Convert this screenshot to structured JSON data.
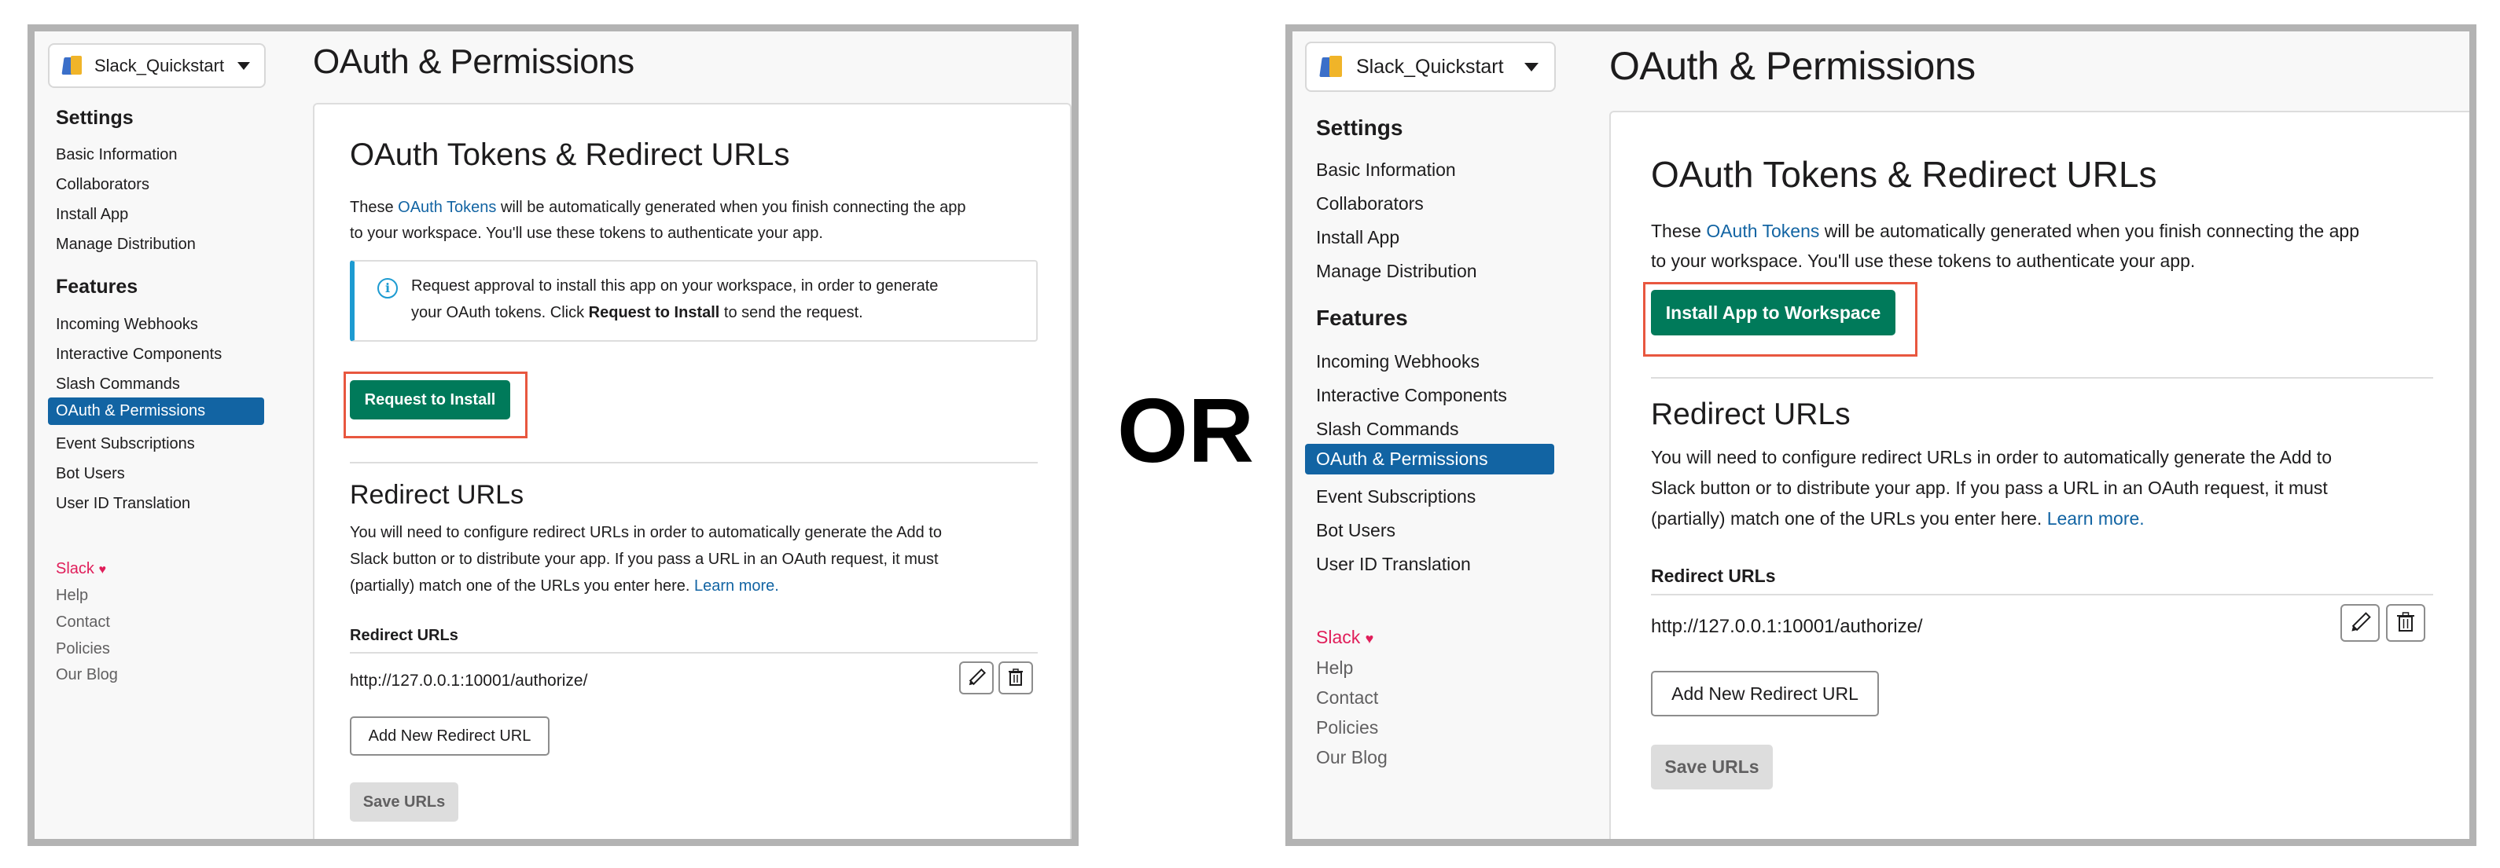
{
  "separator": "OR",
  "workspace": {
    "name": "Slack_Quickstart"
  },
  "sidebar": {
    "settings_heading": "Settings",
    "settings_items": [
      "Basic Information",
      "Collaborators",
      "Install App",
      "Manage Distribution"
    ],
    "features_heading": "Features",
    "features_items": [
      "Incoming Webhooks",
      "Interactive Components",
      "Slash Commands",
      "OAuth & Permissions",
      "Event Subscriptions",
      "Bot Users",
      "User ID Translation"
    ],
    "active_item": "OAuth & Permissions",
    "footer": {
      "slack": "Slack",
      "heart": "♥",
      "items": [
        "Help",
        "Contact",
        "Policies",
        "Our Blog"
      ]
    }
  },
  "page": {
    "title": "OAuth & Permissions",
    "tokens_heading": "OAuth Tokens & Redirect URLs",
    "tokens_desc_pre": "These ",
    "tokens_desc_link": "OAuth Tokens",
    "tokens_desc_post_1": " will be automatically generated when you finish connecting the app",
    "tokens_desc_post_2": "to your workspace. You'll use these tokens to authenticate your app.",
    "info_line1": "Request approval to install this app on your workspace, in order to generate",
    "info_line2_pre": "your OAuth tokens. Click ",
    "info_line2_bold": "Request to Install",
    "info_line2_post": " to send the request.",
    "request_install_button": "Request to Install",
    "install_workspace_button": "Install App to Workspace",
    "redirect_heading": "Redirect URLs",
    "redirect_desc_1": "You will need to configure redirect URLs in order to automatically generate the Add to",
    "redirect_desc_2": "Slack button or to distribute your app. If you pass a URL in an OAuth request, it must",
    "redirect_desc_3_pre": "(partially) match one of the URLs you enter here. ",
    "redirect_desc_link": "Learn more.",
    "redirect_label": "Redirect URLs",
    "redirect_url": "http://127.0.0.1:10001/authorize/",
    "add_button": "Add New Redirect URL",
    "save_button": "Save URLs"
  },
  "colors": {
    "accent_green": "#007a5a",
    "active_blue": "#1264a3",
    "highlight": "#e8573f",
    "link": "#1264a3"
  },
  "icons": [
    "slack-app-logo-icon",
    "chevron-down-icon",
    "info-icon",
    "pencil-icon",
    "trash-icon",
    "heart-icon"
  ]
}
